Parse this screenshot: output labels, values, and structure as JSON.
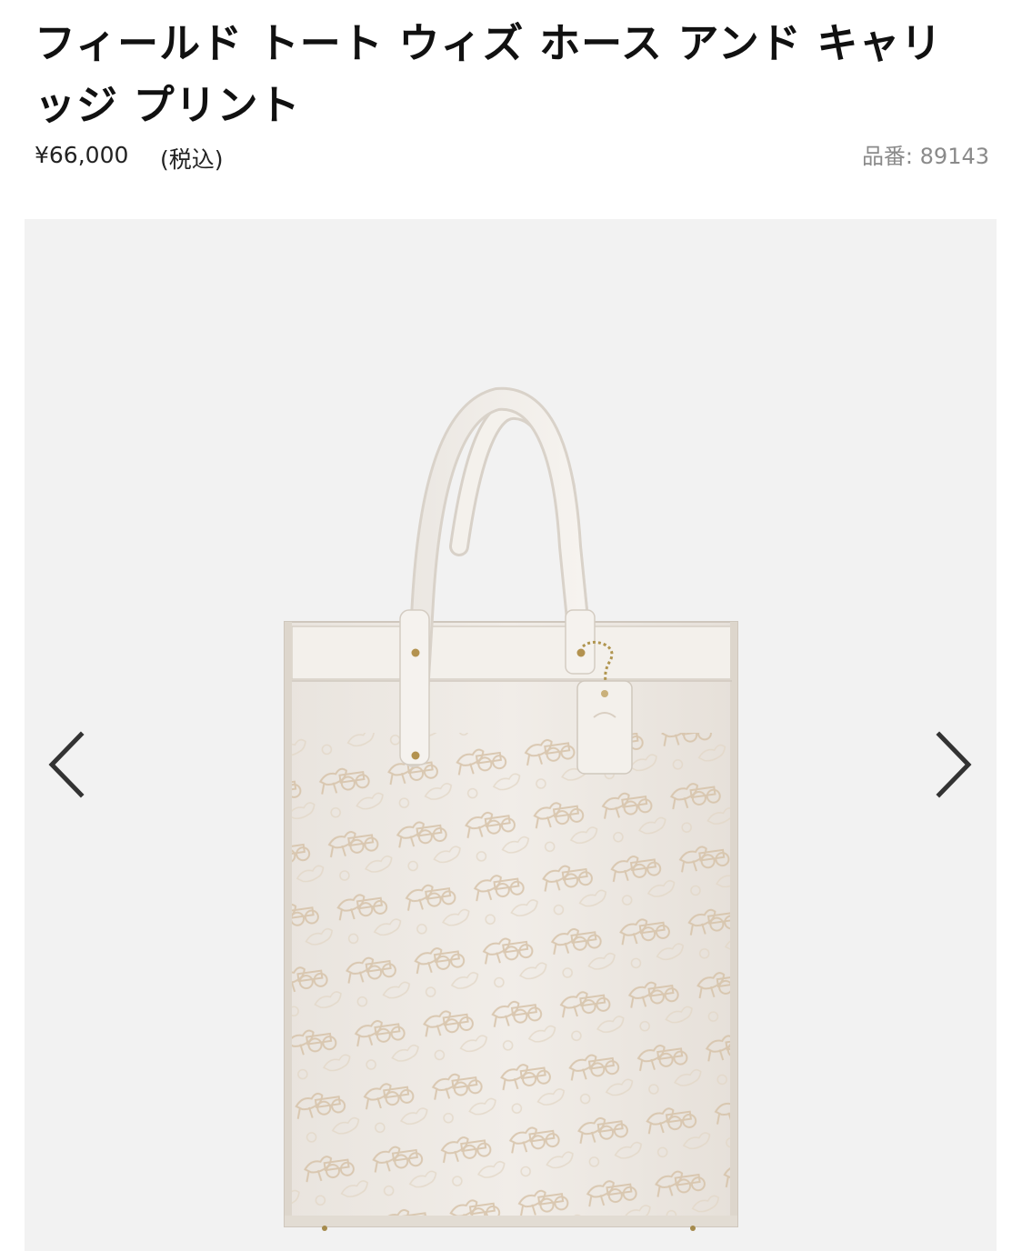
{
  "product": {
    "title": "フィールド トート ウィズ ホース アンド キャリッジ プリント",
    "price": "¥66,000",
    "tax_note": "(税込)",
    "sku_label": "品番: 89143"
  },
  "gallery": {
    "image_name": "tote-bag-image",
    "prev_icon": "chevron-left-icon",
    "next_icon": "chevron-right-icon",
    "background_color": "#f2f2f2",
    "bag_color": "#ece7e1",
    "pattern_color": "#d9c7b0"
  }
}
